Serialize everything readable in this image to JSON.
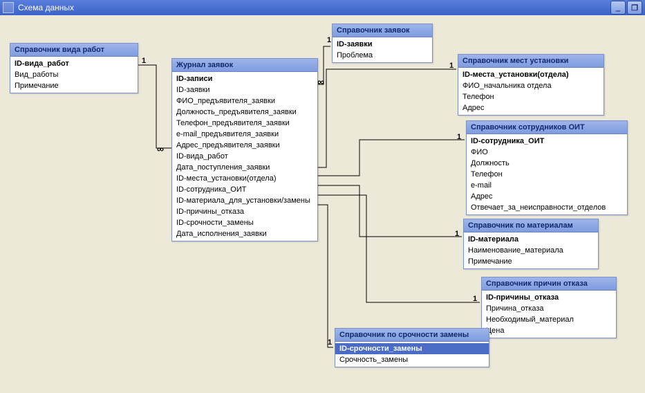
{
  "window": {
    "title": "Схема данных"
  },
  "labels": {
    "one": "1",
    "inf": "∞"
  },
  "tables": {
    "work_type": {
      "title": "Справочник вида работ",
      "fields": [
        "ID-вида_работ",
        "Вид_работы",
        "Примечание"
      ]
    },
    "journal": {
      "title": "Журнал заявок",
      "fields": [
        "ID-записи",
        "ID-заявки",
        "ФИО_предъявителя_заявки",
        "Должность_предъявителя_заявки",
        "Телефон_предъявителя_заявки",
        "e-mail_предъявителя_заявки",
        "Адрес_предъявителя_заявки",
        "ID-вида_работ",
        "Дата_поступления_заявки",
        "ID-места_установки(отдела)",
        "ID-сотрудника_ОИТ",
        "ID-материала_для_установки/замены",
        "ID-причины_отказа",
        "ID-срочности_замены",
        "Дата_исполнения_заявки"
      ]
    },
    "requests_ref": {
      "title": "Справочник заявок",
      "fields": [
        "ID-заявки",
        "Проблема"
      ]
    },
    "install_places": {
      "title": "Справочник мест установки",
      "fields": [
        "ID-места_установки(отдела)",
        "ФИО_начальника отдела",
        "Телефон",
        "Адрес"
      ]
    },
    "oit_employees": {
      "title": "Справочник сотрудников ОИТ",
      "fields": [
        "ID-сотрудника_ОИТ",
        "ФИО",
        "Должность",
        "Телефон",
        "e-mail",
        "Адрес",
        "Отвечает_за_неисправности_отделов"
      ]
    },
    "materials": {
      "title": "Справочник по материалам",
      "fields": [
        "ID-материала",
        "Наименование_материала",
        "Примечание"
      ]
    },
    "reject_reasons": {
      "title": "Справочник причин отказа",
      "fields": [
        "ID-причины_отказа",
        "Причина_отказа",
        "Необходимый_материал",
        "Цена"
      ]
    },
    "urgency": {
      "title": "Справочник по срочности замены",
      "fields": [
        "ID-срочности_замены",
        "Срочность_замены"
      ]
    }
  }
}
